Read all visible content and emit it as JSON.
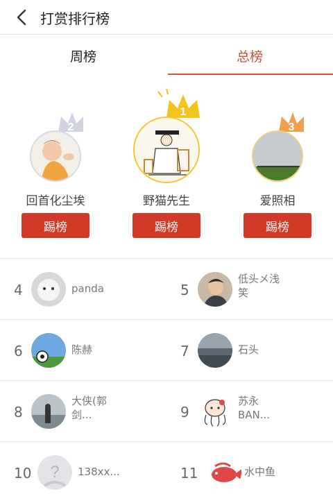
{
  "header": {
    "title": "打赏排行榜"
  },
  "tabs": [
    {
      "label": "周榜",
      "active": false
    },
    {
      "label": "总榜",
      "active": true
    }
  ],
  "colors": {
    "accent": "#c9523a",
    "kick_button": "#d13a28"
  },
  "podium": [
    {
      "rank": 2,
      "name": "回首化尘埃",
      "button": "踢榜"
    },
    {
      "rank": 1,
      "name": "野猫先生",
      "button": "踢榜"
    },
    {
      "rank": 3,
      "name": "爱照相",
      "button": "踢榜"
    }
  ],
  "list": [
    {
      "rank": "4",
      "name_line1": "panda",
      "name_line2": ""
    },
    {
      "rank": "5",
      "name_line1": "低头メ浅",
      "name_line2": "笑"
    },
    {
      "rank": "6",
      "name_line1": "陈赫",
      "name_line2": ""
    },
    {
      "rank": "7",
      "name_line1": "石头",
      "name_line2": ""
    },
    {
      "rank": "8",
      "name_line1": "大侠(郭",
      "name_line2": "剑..."
    },
    {
      "rank": "9",
      "name_line1": "苏永",
      "name_line2": "BAN..."
    },
    {
      "rank": "10",
      "name_line1": "138xx...",
      "name_line2": ""
    },
    {
      "rank": "11",
      "name_line1": "水中鱼",
      "name_line2": ""
    }
  ]
}
